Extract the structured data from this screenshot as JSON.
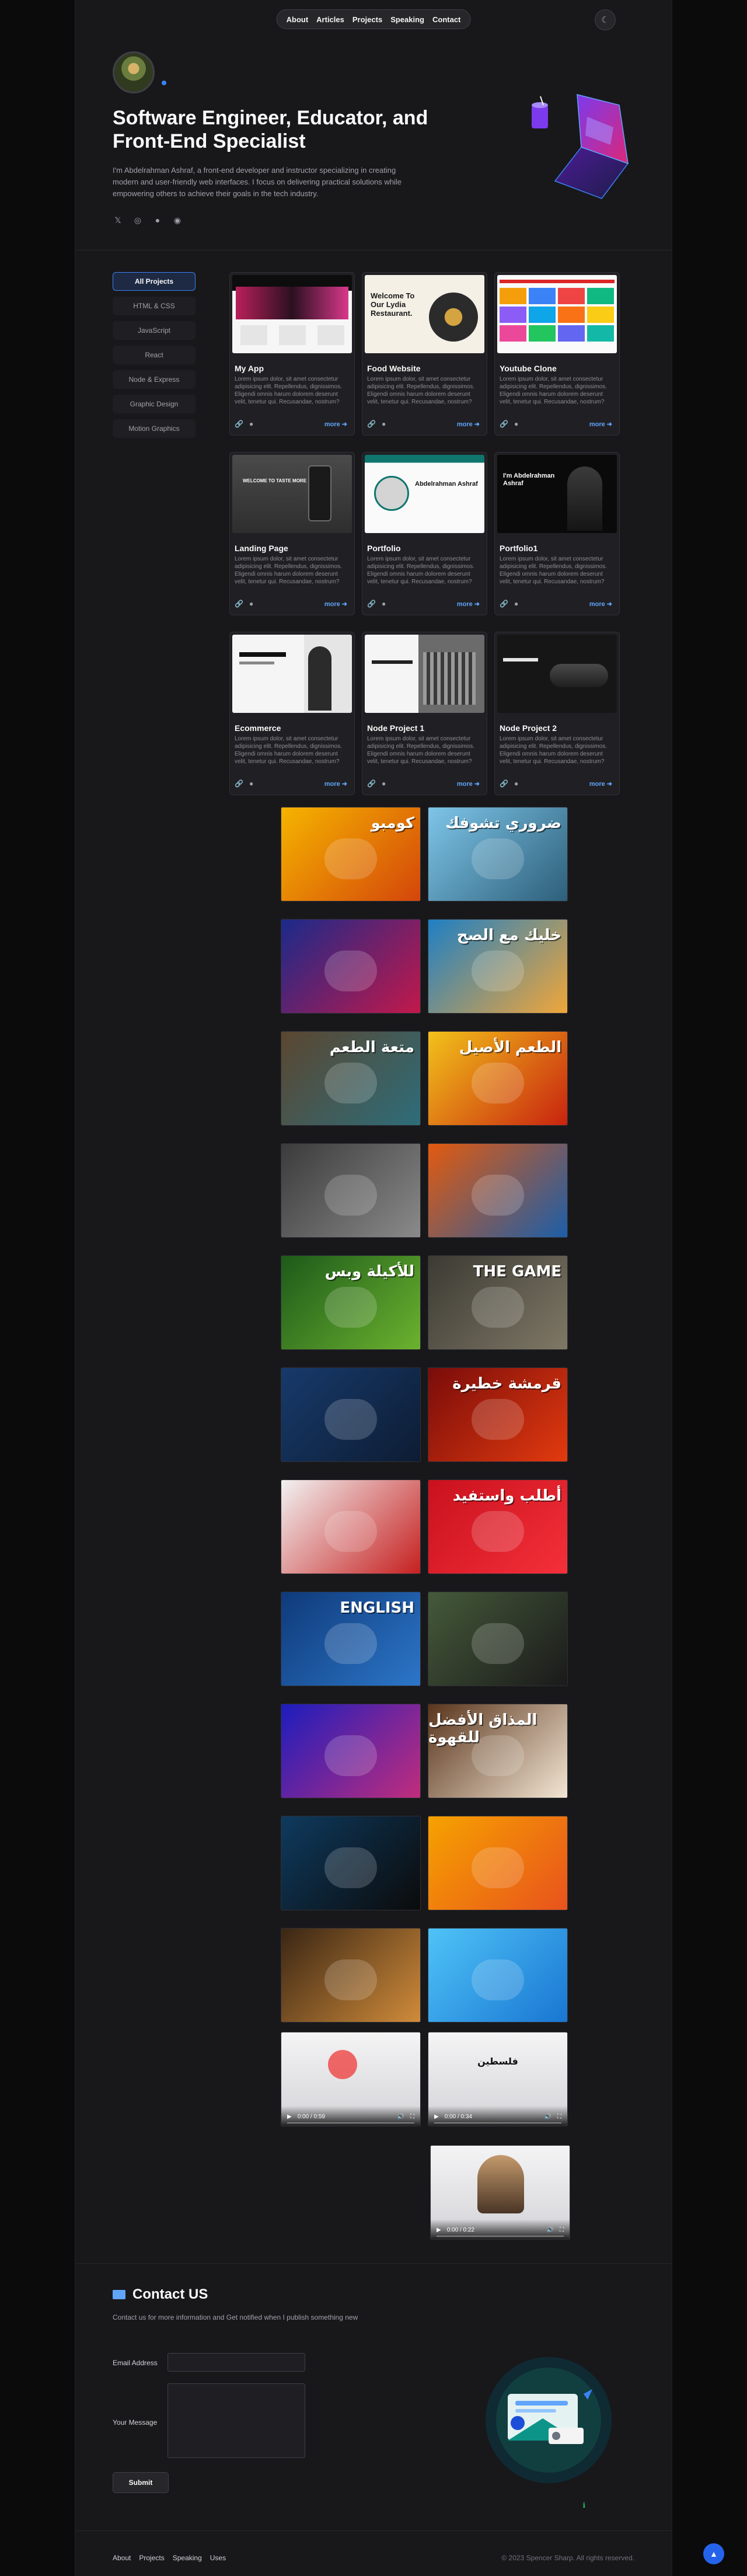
{
  "nav": {
    "links": [
      "About",
      "Articles",
      "Projects",
      "Speaking",
      "Contact"
    ],
    "theme_icon": "moon-icon"
  },
  "hero": {
    "title": "Software Engineer, Educator, and Front-End Specialist",
    "description": "I'm Abdelrahman Ashraf, a front-end developer and instructor specializing in creating modern and user-friendly web interfaces. I focus on delivering practical solutions while empowering others to achieve their goals in the tech industry.",
    "social_icons": [
      "twitter-icon",
      "instagram-icon",
      "github-icon",
      "linkedin-icon"
    ]
  },
  "filters": {
    "items": [
      "All Projects",
      "HTML & CSS",
      "JavaScript",
      "React",
      "Node & Express",
      "Graphic Design",
      "Motion Graphics"
    ],
    "active": "All Projects"
  },
  "projects": [
    {
      "title": "My App",
      "desc": "Lorem ipsum dolor, sit amet consectetur adipisicing elit. Repellendus, dignissimos. Eligendi omnis harum dolorem deserunt velit, tenetur qui. Recusandae, nostrum?",
      "more": "more"
    },
    {
      "title": "Food Website",
      "desc": "Lorem ipsum dolor, sit amet consectetur adipisicing elit. Repellendus, dignissimos. Eligendi omnis harum dolorem deserunt velit, tenetur qui. Recusandae, nostrum?",
      "more": "more",
      "thumb_text": "Welcome To Our Lydia Restaurant."
    },
    {
      "title": "Youtube Clone",
      "desc": "Lorem ipsum dolor, sit amet consectetur adipisicing elit. Repellendus, dignissimos. Eligendi omnis harum dolorem deserunt velit, tenetur qui. Recusandae, nostrum?",
      "more": "more"
    },
    {
      "title": "Landing Page",
      "desc": "Lorem ipsum dolor, sit amet consectetur adipisicing elit. Repellendus, dignissimos. Eligendi omnis harum dolorem deserunt velit, tenetur qui. Recusandae, nostrum?",
      "more": "more",
      "thumb_text": "WELCOME TO TASTE MORE"
    },
    {
      "title": "Portfolio",
      "desc": "Lorem ipsum dolor, sit amet consectetur adipisicing elit. Repellendus, dignissimos. Eligendi omnis harum dolorem deserunt velit, tenetur qui. Recusandae, nostrum?",
      "more": "more",
      "thumb_text": "Abdelrahman Ashraf"
    },
    {
      "title": "Portfolio1",
      "desc": "Lorem ipsum dolor, sit amet consectetur adipisicing elit. Repellendus, dignissimos. Eligendi omnis harum dolorem deserunt velit, tenetur qui. Recusandae, nostrum?",
      "more": "more",
      "thumb_text": "I'm Abdelrahman Ashraf"
    },
    {
      "title": "Ecommerce",
      "desc": "Lorem ipsum dolor, sit amet consectetur adipisicing elit. Repellendus, dignissimos. Eligendi omnis harum dolorem deserunt velit, tenetur qui. Recusandae, nostrum?",
      "more": "more"
    },
    {
      "title": "Node Project 1",
      "desc": "Lorem ipsum dolor, sit amet consectetur adipisicing elit. Repellendus, dignissimos. Eligendi omnis harum dolorem deserunt velit, tenetur qui. Recusandae, nostrum?",
      "more": "more"
    },
    {
      "title": "Node Project 2",
      "desc": "Lorem ipsum dolor, sit amet consectetur adipisicing elit. Repellendus, dignissimos. Eligendi omnis harum dolorem deserunt velit, tenetur qui. Recusandae, nostrum?",
      "more": "more"
    }
  ],
  "gallery": [
    {
      "label": "كومبو",
      "colors": [
        "#f5b400",
        "#d4460a"
      ]
    },
    {
      "label": "ضروري تشوفك",
      "colors": [
        "#7ec5e8",
        "#2d5f7a"
      ]
    },
    {
      "label": "",
      "colors": [
        "#1a2a8a",
        "#c2184a"
      ]
    },
    {
      "label": "خليك مع الصح",
      "colors": [
        "#1e7fc4",
        "#f0a63a"
      ]
    },
    {
      "label": "متعة الطعم",
      "colors": [
        "#5b4630",
        "#2d6d7a"
      ]
    },
    {
      "label": "الطعم الأصيل",
      "colors": [
        "#f2c21a",
        "#c8230f"
      ]
    },
    {
      "label": "",
      "colors": [
        "#3b3b3b",
        "#8a8a8a"
      ]
    },
    {
      "label": "",
      "colors": [
        "#e35a0e",
        "#1c5ea8"
      ]
    },
    {
      "label": "للأكيلة وبس",
      "colors": [
        "#1d5a1a",
        "#6cb22f"
      ]
    },
    {
      "label": "THE GAME",
      "colors": [
        "#3c3a33",
        "#7f7866"
      ]
    },
    {
      "label": "",
      "colors": [
        "#173a6b",
        "#0d1c33"
      ]
    },
    {
      "label": "قرمشة خطيرة",
      "colors": [
        "#7a0c0a",
        "#e23a0f"
      ]
    },
    {
      "label": "",
      "colors": [
        "#f2f2f2",
        "#c62020"
      ]
    },
    {
      "label": "أطلب واستفيد",
      "colors": [
        "#c9111d",
        "#f4303a"
      ]
    },
    {
      "label": "ENGLISH",
      "colors": [
        "#0f3a7a",
        "#2c76c8"
      ]
    },
    {
      "label": "",
      "colors": [
        "#455a3a",
        "#1a1a1a"
      ]
    },
    {
      "label": "",
      "colors": [
        "#1c1dbd",
        "#c12d7c"
      ]
    },
    {
      "label": "المذاق الأفضل للقهوة",
      "colors": [
        "#5a351c",
        "#f3e6d4"
      ]
    },
    {
      "label": "",
      "colors": [
        "#0e3a5e",
        "#0b0b0b"
      ]
    },
    {
      "label": "",
      "colors": [
        "#f6a200",
        "#e8531c"
      ]
    },
    {
      "label": "",
      "colors": [
        "#3a2614",
        "#d08b3a"
      ]
    },
    {
      "label": "",
      "colors": [
        "#4fc3f7",
        "#1976d2"
      ]
    }
  ],
  "videos": [
    {
      "time": "0:00 / 0:59"
    },
    {
      "time": "0:00 / 0:34",
      "label": "فلسطين"
    },
    {
      "time": "0:00 / 0:22"
    }
  ],
  "contact": {
    "title": "Contact US",
    "subtitle": "Contact us for more information and Get notified when I publish something new",
    "email_label": "Email Address",
    "message_label": "Your Message",
    "submit": "Submit"
  },
  "footer": {
    "links": [
      "About",
      "Projects",
      "Speaking",
      "Uses"
    ],
    "copyright": "© 2023 Spencer Sharp. All rights reserved."
  }
}
